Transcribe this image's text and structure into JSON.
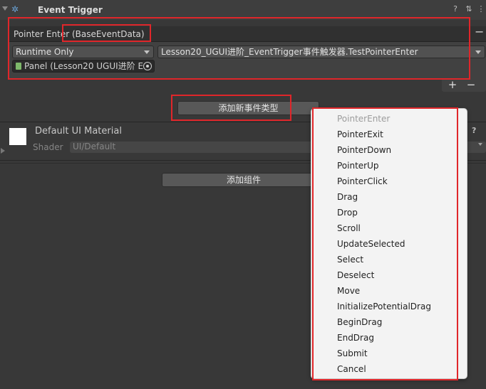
{
  "component": {
    "title": "Event Trigger",
    "help_icon": "help-icon",
    "settings_icon": "sliders-icon",
    "menu_icon": "kebab-menu-icon"
  },
  "event_entry": {
    "label": "Pointer Enter (BaseEventData)",
    "remove_label": "−",
    "runtime_mode": "Runtime Only",
    "function": "Lesson20_UGUI进阶_EventTrigger事件触发器.TestPointerEnter",
    "target_object": "Panel (Lesson20 UGUI进阶 E"
  },
  "list_controls": {
    "add_label": "+",
    "remove_label": "−"
  },
  "add_event_type_button": "添加新事件类型",
  "material": {
    "name": "Default UI Material",
    "shader_label": "Shader",
    "shader_value": "UI/Default"
  },
  "add_component_button": "添加组件",
  "event_type_menu": {
    "items": [
      {
        "label": "PointerEnter",
        "enabled": false
      },
      {
        "label": "PointerExit",
        "enabled": true
      },
      {
        "label": "PointerDown",
        "enabled": true
      },
      {
        "label": "PointerUp",
        "enabled": true
      },
      {
        "label": "PointerClick",
        "enabled": true
      },
      {
        "label": "Drag",
        "enabled": true
      },
      {
        "label": "Drop",
        "enabled": true
      },
      {
        "label": "Scroll",
        "enabled": true
      },
      {
        "label": "UpdateSelected",
        "enabled": true
      },
      {
        "label": "Select",
        "enabled": true
      },
      {
        "label": "Deselect",
        "enabled": true
      },
      {
        "label": "Move",
        "enabled": true
      },
      {
        "label": "InitializePotentialDrag",
        "enabled": true
      },
      {
        "label": "BeginDrag",
        "enabled": true
      },
      {
        "label": "EndDrag",
        "enabled": true
      },
      {
        "label": "Submit",
        "enabled": true
      },
      {
        "label": "Cancel",
        "enabled": true
      }
    ]
  },
  "colors": {
    "highlight_border": "#e0262a",
    "panel_bg": "#383838",
    "menu_bg": "#f3f3f3"
  }
}
